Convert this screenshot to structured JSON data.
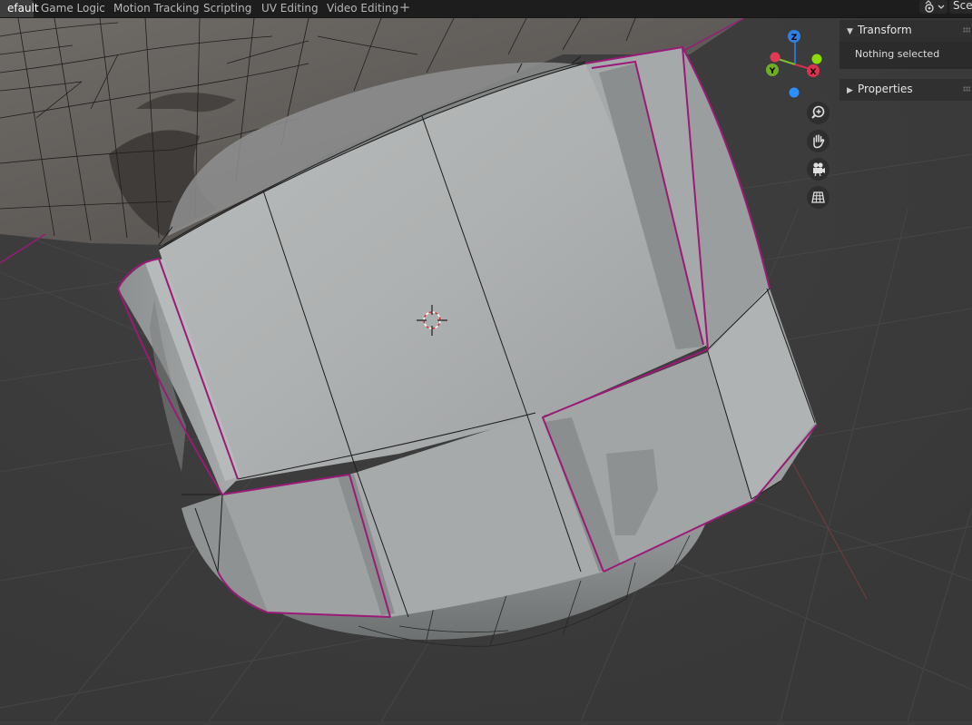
{
  "workspace_tabs": [
    {
      "label": "efault",
      "active": true
    },
    {
      "label": "Game Logic",
      "active": false
    },
    {
      "label": "Motion Tracking",
      "active": false
    },
    {
      "label": "Scripting",
      "active": false
    },
    {
      "label": "UV Editing",
      "active": false
    },
    {
      "label": "Video Editing",
      "active": false
    }
  ],
  "add_workspace_label": "+",
  "scene": {
    "label": "Scer",
    "icon": "scene-icon"
  },
  "sidebar": {
    "transform": {
      "title": "Transform",
      "expanded": true,
      "body": "Nothing selected"
    },
    "properties": {
      "title": "Properties",
      "expanded": false
    }
  },
  "gizmo": {
    "z": "Z",
    "y": "Y",
    "x": "X"
  },
  "nav_buttons": [
    "zoom-icon",
    "pan-hand-icon",
    "camera-icon",
    "grid-view-icon"
  ],
  "colors": {
    "selection_edge": "#9b1a78",
    "x_axis": "#ff3352",
    "y_axis": "#8bdc00",
    "z_axis": "#2890ff"
  }
}
